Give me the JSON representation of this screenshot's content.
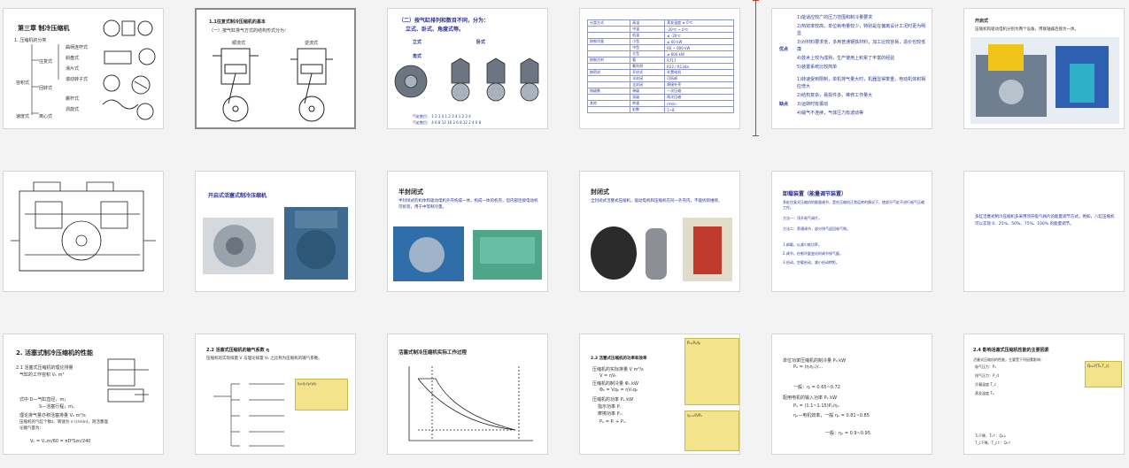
{
  "slides": {
    "s1": {
      "title": "第三章  制冷压缩机",
      "heading": "1. 压缩机的分类",
      "root": "容积式",
      "root2": "速度式",
      "items": [
        "往复式",
        "回转式",
        "离心式"
      ],
      "subitems": [
        "曲柄连杆式",
        "斜盘式",
        "滑片式",
        "滚动转子式",
        "螺杆式",
        "涡旋式"
      ]
    },
    "s2": {
      "title": "1.1往复式制冷压缩机的基本",
      "subtitle": "（一）按气缸排气方式的结构形式分为：",
      "left_label": "顺流式",
      "right_label": "逆流式"
    },
    "s3": {
      "title": "（二）按气缸排列和数目不同，分为：",
      "subtitle": "立式、卧式、角度式等。",
      "labels": [
        "立式",
        "卧式",
        "角式"
      ],
      "caption1": "气缸数目：  1  2  3  4      1  2  3  4      1  2  3  4",
      "caption2": "气缸数目：  4  6  8  12  16      2  6  8  12      2  4  6  8"
    },
    "s5": {
      "top": "1)能适应较广的压力范围和制冷量要求",
      "lines": [
        "2)热效率较高，单位耗电量较少，特别是在偏离设计工况时更为明显",
        "3)对材料要求低，多用普通钢铁材料，加工比较容易，造价也较低廉",
        "4)技术上较为成熟，生产使用上积累了丰富的经验",
        "5)装置系统比较简单",
        "1)转速受到限制，单机排气量大时，机器显得笨重，电动机体积相应增大",
        "2)结构复杂，易损件多，维修工作量大",
        "3)运转时有振动",
        "4)输气不连续，气体压力有波动等"
      ],
      "pros": "优点",
      "cons": "缺点"
    },
    "s6": {
      "title": "开启式",
      "text": "压缩机和驱动电机分别为两个设备，用联轴器连接为一体。"
    },
    "s8": {
      "title": "开启式活塞式制冷压缩机"
    },
    "s9": {
      "title": "半封闭式",
      "text": "半封闭式的机体和驱动电机外壳构成一体，构成一体的机壳，但内部连接电动机可拆装，用于中等制冷量。"
    },
    "s10": {
      "title": "封闭式",
      "text": "全封闭式活塞式压缩机，驱动电机和压缩机在同一外壳内，不能拆卸维修。"
    },
    "s11": {
      "title": "卸载装置（能量调节装置）",
      "lines": [
        "多缸往复式压缩机的能量调节，是在压缩机正常运转的情况下，使部分气缸不进行吸气压缩工作。",
        "方法一：顶开吸气阀片。",
        "方法二：旁通调节，部分排气返回吸气侧。",
        "1.卸载，以减少耗功率。",
        "2.调节，在制冷量变化时调节排气量。",
        "3.启动，空载启动，减小启动转矩。"
      ]
    },
    "s12": {
      "text": "多缸活塞式制冷压缩机多采用顶开吸气阀片的能量调节方式，例如，八缸压缩机可以实现 0、25%、50%、75%、100% 的能量调节。"
    },
    "s13": {
      "title": "2. 活塞式制冷压缩机的性能",
      "sub": "2.1 活塞式压缩机的理论排量",
      "l1": "气缸的工作容积 Vₕ  m³",
      "l2": "式中  D—气缸直径，m；",
      "l3": "S—活塞行程，m。",
      "l4": "理论排气量亦称活塞排量 Vₕ  m³/s",
      "l5": "压缩机的气缸个数z、转速为 n (r/min)，则活塞理论输气量为：",
      "l6": "Vₕ = Vₙzn/60 = πD²Szn/240"
    },
    "s14": {
      "title": "2.2 活塞式压缩机的输气系数 η",
      "text": "压缩机的实际排量 V 与理论排量 Vₕ 之比称为压缩机的输气系数。"
    },
    "s15": {
      "title": "活塞式制冷压缩机实际工作过程"
    },
    "s16": {
      "title": "2.3 活塞式压缩机的功率和效率",
      "lines": [
        "压缩机的实际排量  V   m³/s",
        "V = ηVₕ",
        "压缩机的制冷量  Φ₀  kW",
        "Φ₀ = Vq₀ = ηVₕq₀",
        "压缩机的功率  Pₑ  kW",
        "指示功率  Pᵢ",
        "摩擦功率  Pₘ",
        "Pₑ = Pᵢ + Pₘ"
      ]
    },
    "s17": {
      "lines": [
        "单位功率压缩机的制冷量  P₀  kW",
        "Pₑ = (ηᵢηₘ)/... ",
        "一般：ηᵢ = 0.65~0.72",
        "配用电机的输入功率  Pₑ  kW",
        "Pₑ = (1.1~1.15)Pₑ/ηₑ",
        "ηₑ—电机效率，一般 ηₑ = 0.81~0.85",
        "一般：ηₑ = 0.9~0.95"
      ]
    },
    "s18": {
      "title": "2.4  影响活塞式压缩机性能的主要因素",
      "lines": [
        "活塞式压缩机的性能，主要受下列因素影响：",
        "吸气压力：Pₛ",
        "排气压力：P_d",
        "冷凝温度 T_c",
        "蒸发温度 T₀",
        "T₀下降，T₀↑：Q₀↓",
        "T_c下降，T_c↑：Q₀↑"
      ]
    }
  },
  "colors": {
    "accent_blue": "#2a3a9a",
    "marker_red": "#c0392b",
    "note_yellow": "#f3e38a"
  }
}
